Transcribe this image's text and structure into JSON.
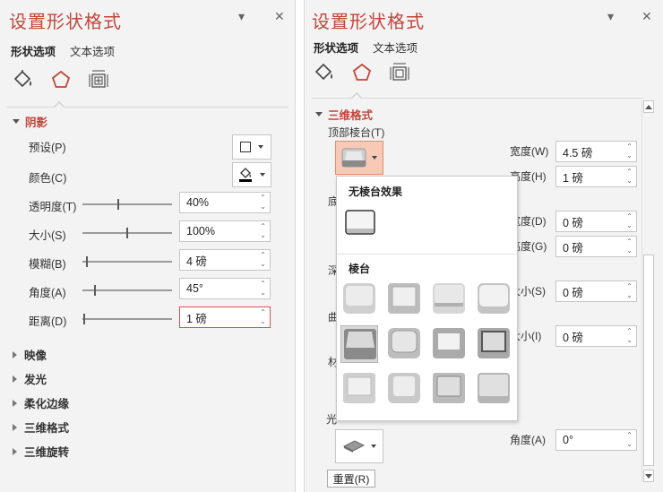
{
  "left_panel": {
    "title": "设置形状格式",
    "tabs": {
      "shape": "形状选项",
      "text": "文本选项"
    },
    "section_shadow": {
      "label": "阴影",
      "preset_label": "预设(P)",
      "color_label": "颜色(C)",
      "transparency": {
        "label": "透明度(T)",
        "value": "40%",
        "level": 0.4
      },
      "size": {
        "label": "大小(S)",
        "value": "100%",
        "level": 0.5
      },
      "blur": {
        "label": "模糊(B)",
        "value": "4 磅",
        "level": 0.04
      },
      "angle": {
        "label": "角度(A)",
        "value": "45°",
        "level": 0.13
      },
      "distance": {
        "label": "距离(D)",
        "value": "1 磅",
        "level": 0.01
      }
    },
    "collapsed": [
      "映像",
      "发光",
      "柔化边缘",
      "三维格式",
      "三维旋转"
    ]
  },
  "right_panel": {
    "title": "设置形状格式",
    "tabs": {
      "shape": "形状选项",
      "text": "文本选项"
    },
    "section_3d": "三维格式",
    "top_bevel_label": "顶部棱台(T)",
    "width": {
      "label": "宽度(W)",
      "value": "4.5 磅"
    },
    "height": {
      "label": "高度(H)",
      "value": "1 磅"
    },
    "width2": {
      "label": "宽度(D)",
      "value": "0 磅"
    },
    "height2": {
      "label": "高度(G)",
      "value": "0 磅"
    },
    "size1": {
      "label": "大小(S)",
      "value": "0 磅"
    },
    "size2": {
      "label": "大小(I)",
      "value": "0 磅"
    },
    "angle": {
      "label": "角度(A)",
      "value": "0°"
    },
    "cut_labels": [
      "底",
      "深",
      "曲",
      "材",
      "光"
    ],
    "reset": "重置(R)",
    "popup": {
      "no_bevel": "无棱台效果",
      "bevel": "棱台"
    }
  },
  "colors": {
    "accent": "#c0463a",
    "panel_bg": "#f3f3f3",
    "highlight_border": "#d9534f"
  }
}
